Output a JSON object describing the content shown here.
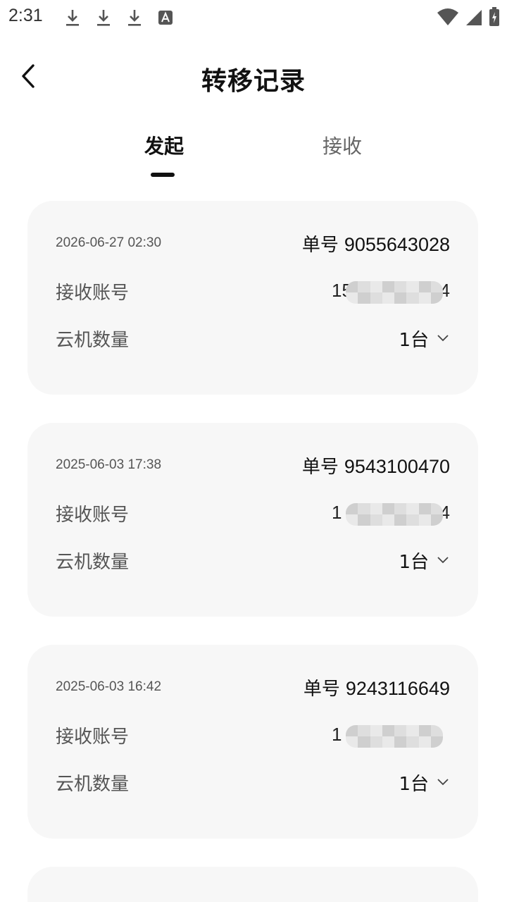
{
  "status_bar": {
    "time": "2:31"
  },
  "header": {
    "title": "转移记录"
  },
  "tabs": [
    {
      "label": "发起",
      "active": true
    },
    {
      "label": "接收",
      "active": false
    }
  ],
  "cards": [
    {
      "time": "2026-06-27 02:30",
      "order_label": "单号",
      "order_number": "9055643028",
      "account_label": "接收账号",
      "account_prefix": "15",
      "account_suffix": "4",
      "count_label": "云机数量",
      "count_value": "1台"
    },
    {
      "time": "2025-06-03 17:38",
      "order_label": "单号",
      "order_number": "9543100470",
      "account_label": "接收账号",
      "account_prefix": "1",
      "account_suffix": "4",
      "count_label": "云机数量",
      "count_value": "1台"
    },
    {
      "time": "2025-06-03 16:42",
      "order_label": "单号",
      "order_number": "9243116649",
      "account_label": "接收账号",
      "account_prefix": "1",
      "account_suffix": "",
      "count_label": "云机数量",
      "count_value": "1台"
    }
  ],
  "colors": {
    "card_bg": "#f7f7f7",
    "text_primary": "#111111",
    "text_secondary": "#555555"
  },
  "icons": {
    "back": "chevron-left-icon",
    "expand": "chevron-down-icon",
    "download": "download-icon",
    "wifi": "wifi-icon",
    "signal": "signal-icon",
    "battery": "battery-charging-icon"
  }
}
